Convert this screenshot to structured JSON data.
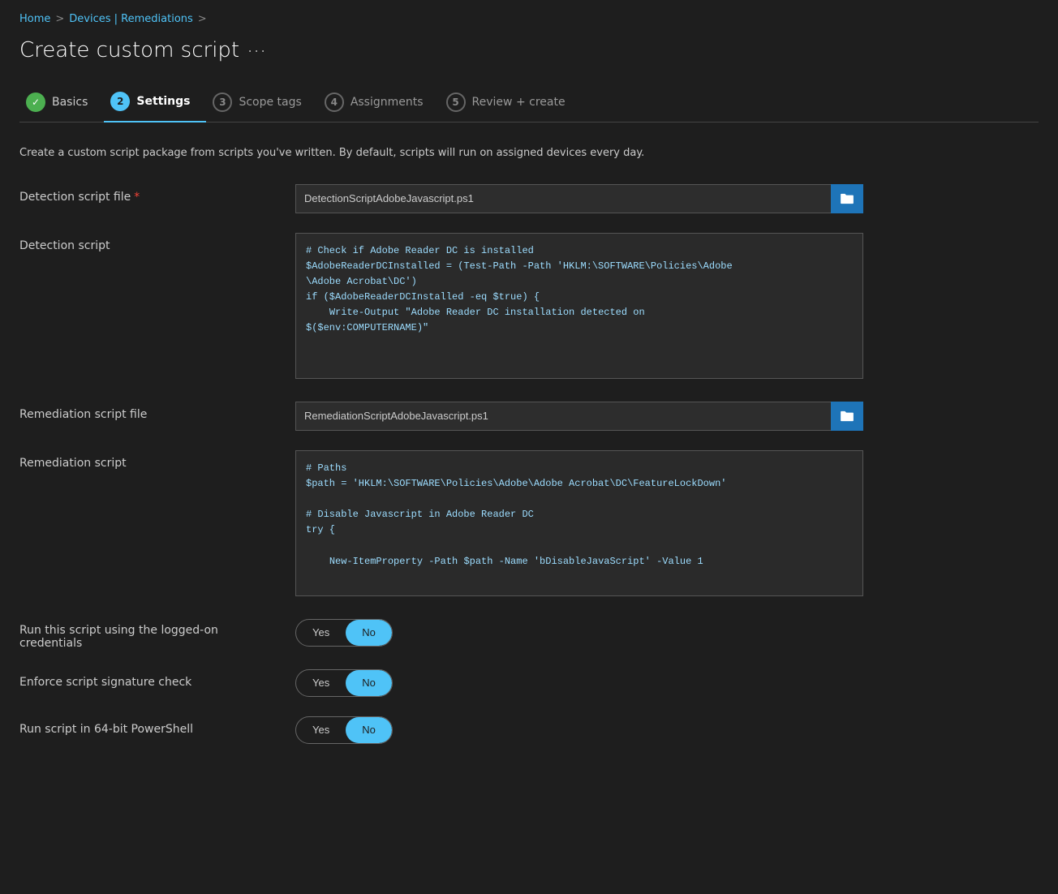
{
  "breadcrumb": {
    "home": "Home",
    "separator1": ">",
    "devices": "Devices | Remediations",
    "separator2": ">"
  },
  "page": {
    "title": "Create custom script",
    "ellipsis": "···"
  },
  "wizard": {
    "steps": [
      {
        "id": "basics",
        "number": "✓",
        "label": "Basics",
        "state": "completed"
      },
      {
        "id": "settings",
        "number": "2",
        "label": "Settings",
        "state": "active"
      },
      {
        "id": "scope-tags",
        "number": "3",
        "label": "Scope tags",
        "state": "inactive"
      },
      {
        "id": "assignments",
        "number": "4",
        "label": "Assignments",
        "state": "inactive"
      },
      {
        "id": "review-create",
        "number": "5",
        "label": "Review + create",
        "state": "inactive"
      }
    ]
  },
  "description": "Create a custom script package from scripts you've written. By default, scripts will run on assigned devices every day.",
  "form": {
    "detection_script_file": {
      "label": "Detection script file",
      "required": true,
      "value": "DetectionScriptAdobeJavascript.ps1",
      "placeholder": ""
    },
    "detection_script": {
      "label": "Detection script",
      "content": "# Check if Adobe Reader DC is installed\n$AdobeReaderDCInstalled = (Test-Path -Path 'HKLM:\\SOFTWARE\\Policies\\Adobe\n\\Adobe Acrobat\\DC')\nif ($AdobeReaderDCInstalled -eq $true) {\n    Write-Output \"Adobe Reader DC installation detected on\n$($env:COMPUTERNAME)\""
    },
    "remediation_script_file": {
      "label": "Remediation script file",
      "required": false,
      "value": "RemediationScriptAdobeJavascript.ps1",
      "placeholder": ""
    },
    "remediation_script": {
      "label": "Remediation script",
      "content": "# Paths\n$path = 'HKLM:\\SOFTWARE\\Policies\\Adobe\\Adobe Acrobat\\DC\\FeatureLockDown'\n\n# Disable Javascript in Adobe Reader DC\ntry {\n\n    New-ItemProperty -Path $path -Name 'bDisableJavaScript' -Value 1"
    },
    "run_logged_on": {
      "label": "Run this script using the logged-on credentials",
      "yes_label": "Yes",
      "no_label": "No",
      "selected": "No"
    },
    "enforce_signature": {
      "label": "Enforce script signature check",
      "yes_label": "Yes",
      "no_label": "No",
      "selected": "No"
    },
    "run_64bit": {
      "label": "Run script in 64-bit PowerShell",
      "yes_label": "Yes",
      "no_label": "No",
      "selected": "No"
    }
  }
}
